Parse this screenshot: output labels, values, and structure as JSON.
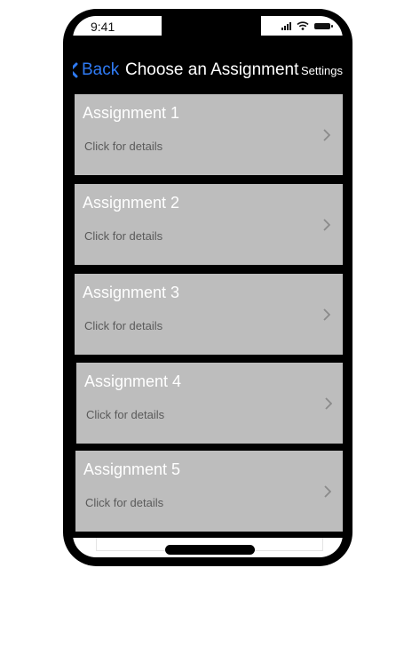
{
  "status_bar": {
    "time": "9:41",
    "icons": [
      "signal-icon",
      "wifi-icon",
      "battery-icon"
    ]
  },
  "nav": {
    "back_label": "Back",
    "title": "Choose an Assignment",
    "settings_label": "Settings",
    "accent_color": "#2f7bf5"
  },
  "assignments": [
    {
      "title": "Assignment 1",
      "subtitle": "Click for details"
    },
    {
      "title": "Assignment 2",
      "subtitle": "Click for details"
    },
    {
      "title": "Assignment 3",
      "subtitle": "Click for details"
    },
    {
      "title": "Assignment 4",
      "subtitle": "Click for details"
    },
    {
      "title": "Assignment 5",
      "subtitle": "Click for details"
    }
  ],
  "colors": {
    "card_background": "#bdbdbd",
    "screen_background": "#000000"
  }
}
